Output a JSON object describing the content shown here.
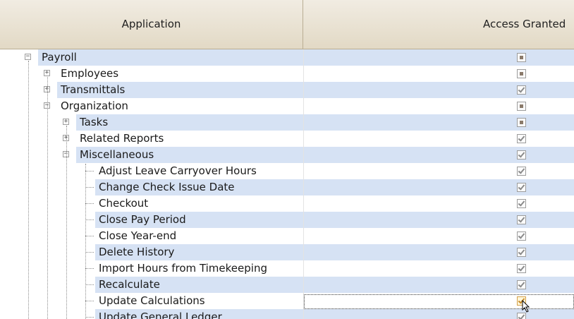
{
  "columns": {
    "application": "Application",
    "access": "Access Granted"
  },
  "rows": [
    {
      "label": "Payroll",
      "level": 0,
      "expander": "−",
      "access": "partial"
    },
    {
      "label": "Employees",
      "level": 1,
      "expander": "+",
      "access": "partial"
    },
    {
      "label": "Transmittals",
      "level": 1,
      "expander": "+",
      "access": "granted"
    },
    {
      "label": "Organization",
      "level": 1,
      "expander": "−",
      "access": "partial"
    },
    {
      "label": "Tasks",
      "level": 2,
      "expander": "+",
      "access": "partial"
    },
    {
      "label": "Related Reports",
      "level": 2,
      "expander": "+",
      "access": "granted"
    },
    {
      "label": "Miscellaneous",
      "level": 2,
      "expander": "−",
      "access": "granted"
    },
    {
      "label": "Adjust Leave Carryover Hours",
      "level": 3,
      "expander": "",
      "access": "granted"
    },
    {
      "label": "Change Check Issue Date",
      "level": 3,
      "expander": "",
      "access": "granted"
    },
    {
      "label": "Checkout",
      "level": 3,
      "expander": "",
      "access": "granted"
    },
    {
      "label": "Close Pay Period",
      "level": 3,
      "expander": "",
      "access": "granted"
    },
    {
      "label": "Close Year-end",
      "level": 3,
      "expander": "",
      "access": "granted"
    },
    {
      "label": "Delete History",
      "level": 3,
      "expander": "",
      "access": "granted"
    },
    {
      "label": "Import Hours from Timekeeping",
      "level": 3,
      "expander": "",
      "access": "granted"
    },
    {
      "label": "Recalculate",
      "level": 3,
      "expander": "",
      "access": "granted"
    },
    {
      "label": "Update Calculations",
      "level": 3,
      "expander": "",
      "access": "granted"
    },
    {
      "label": "Update General Ledger",
      "level": 3,
      "expander": "",
      "access": "granted"
    }
  ],
  "colors": {
    "header_bg": "#e8e1d2",
    "alt_row": "#d6e2f4",
    "focus_row_index": 15
  }
}
